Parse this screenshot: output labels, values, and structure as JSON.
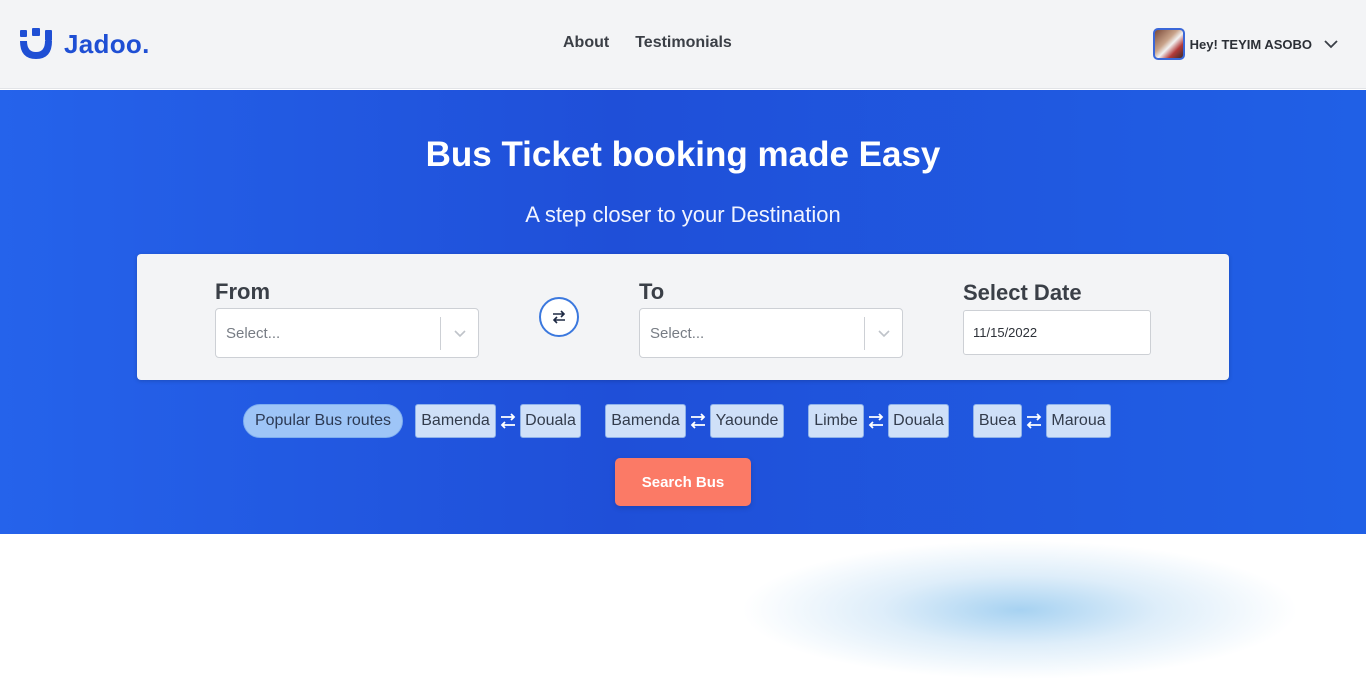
{
  "brand": {
    "name": "Jadoo.",
    "icon": "jadoo-logo-icon",
    "color": "#1f4fd4"
  },
  "nav": {
    "items": [
      {
        "label": "About"
      },
      {
        "label": "Testimonials"
      }
    ]
  },
  "user": {
    "greeting": "Hey! TEYIM ASOBO",
    "icon": "chevron-down-icon"
  },
  "hero": {
    "title": "Bus Ticket booking made Easy",
    "subtitle": "A step closer to your Destination",
    "background": "#2563eb"
  },
  "search": {
    "from_label": "From",
    "from_placeholder": "Select...",
    "to_label": "To",
    "to_placeholder": "Select...",
    "date_label": "Select Date",
    "date_value": "11/15/2022",
    "swap_icon": "swap-arrows-icon"
  },
  "routes": {
    "label": "Popular Bus routes",
    "items": [
      {
        "from": "Bamenda",
        "to": "Douala"
      },
      {
        "from": "Bamenda",
        "to": "Yaounde"
      },
      {
        "from": "Limbe",
        "to": "Douala"
      },
      {
        "from": "Buea",
        "to": "Maroua"
      }
    ]
  },
  "action": {
    "search_label": "Search Bus",
    "color": "#fb7a66"
  }
}
